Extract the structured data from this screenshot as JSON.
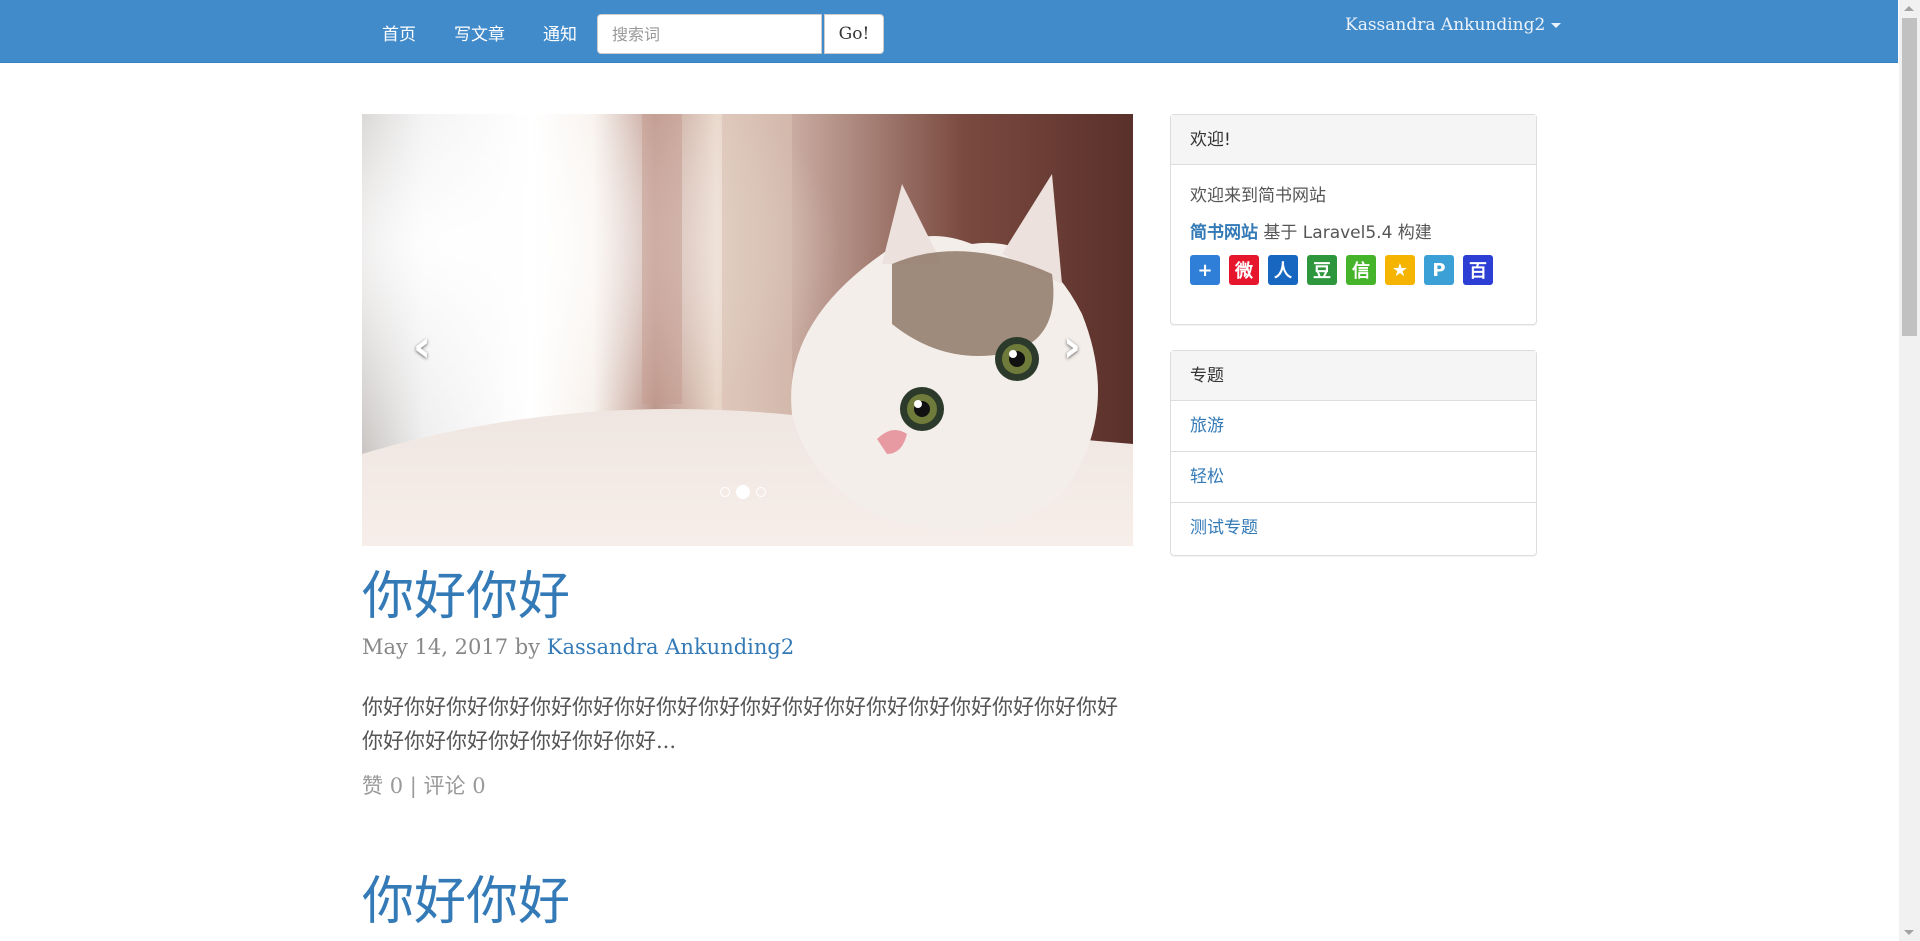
{
  "nav": {
    "home": "首页",
    "write": "写文章",
    "notice": "通知",
    "search_placeholder": "搜索词",
    "search_button": "Go!",
    "user": "Kassandra Ankunding2"
  },
  "carousel": {
    "prev_icon": "chevron-left-icon",
    "next_icon": "chevron-right-icon",
    "slide_count": 3,
    "active_index": 1
  },
  "posts": [
    {
      "title": "你好你好",
      "date": "May 14, 2017",
      "by": "by",
      "author": "Kassandra Ankunding2",
      "excerpt": "你好你好你好你好你好你好你好你好你好你好你好你好你好你好你好你好你好你好你好你好你好你好你好你好你好...",
      "likes_label": "赞",
      "likes": "0",
      "separator": "|",
      "comments_label": "评论",
      "comments": "0"
    },
    {
      "title": "你好你好"
    }
  ],
  "sidebar": {
    "welcome": {
      "heading": "欢迎!",
      "line1": "欢迎来到简书网站",
      "brand": "简书网站",
      "line2_rest": "基于 Laravel5.4 构建",
      "share_icons": [
        {
          "name": "share-more-icon",
          "glyph": "+",
          "color": "#2f7fd8"
        },
        {
          "name": "weibo-icon",
          "glyph": "微",
          "color": "#e6162d"
        },
        {
          "name": "renren-icon",
          "glyph": "人",
          "color": "#1767c0"
        },
        {
          "name": "douban-icon",
          "glyph": "豆",
          "color": "#2e963d"
        },
        {
          "name": "wechat-icon",
          "glyph": "信",
          "color": "#46b42a"
        },
        {
          "name": "qzone-icon",
          "glyph": "★",
          "color": "#f4b400"
        },
        {
          "name": "tencent-weibo-icon",
          "glyph": "P",
          "color": "#3aa0d6"
        },
        {
          "name": "baidu-icon",
          "glyph": "百",
          "color": "#2c3ed4"
        }
      ]
    },
    "topics": {
      "heading": "专题",
      "items": [
        "旅游",
        "轻松",
        "测试专题"
      ]
    }
  }
}
